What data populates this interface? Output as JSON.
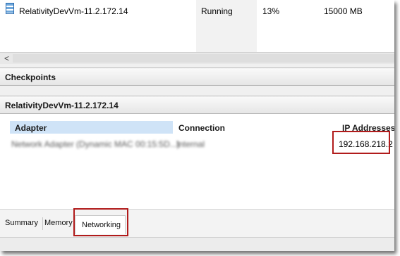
{
  "vm_list": {
    "row": {
      "name": "RelativityDevVm-11.2.172.14",
      "state": "Running",
      "cpu": "13%",
      "memory": "15000 MB"
    },
    "scroll_left_glyph": "<"
  },
  "checkpoints_header": "Checkpoints",
  "vm_detail_header": "RelativityDevVm-11.2.172.14",
  "networking_table": {
    "columns": [
      "Adapter",
      "Connection",
      "IP Addresses"
    ],
    "rows": [
      {
        "adapter": "Network Adapter (Dynamic MAC 00:15:5D...)",
        "connection": "Internal",
        "ip": "192.168.218.2"
      }
    ]
  },
  "tabs": [
    "Summary",
    "Memory",
    "Networking"
  ],
  "accent_colors": {
    "highlight_box": "#b11b1b",
    "header_selected": "#cfe3f7"
  }
}
